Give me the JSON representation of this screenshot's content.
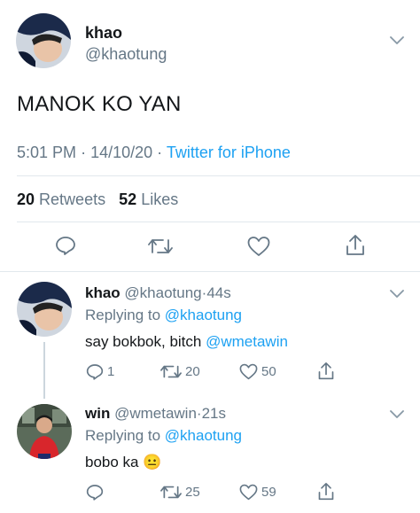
{
  "main_tweet": {
    "name": "khao",
    "handle": "@khaotung",
    "text": "MANOK KO YAN",
    "time": "5:01 PM",
    "date": "14/10/20",
    "separator": "·",
    "source": "Twitter for iPhone",
    "retweets_count": "20",
    "retweets_label": "Retweets",
    "likes_count": "52",
    "likes_label": "Likes"
  },
  "replies": [
    {
      "name": "khao",
      "handle": "@khaotung",
      "separator": "·",
      "time": "44s",
      "replying_prefix": "Replying to",
      "replying_to": "@khaotung",
      "text": "say bokbok, bitch",
      "mention": "@wmetawin",
      "reply_count": "1",
      "retweet_count": "20",
      "like_count": "50"
    },
    {
      "name": "win",
      "handle": "@wmetawin",
      "separator": "·",
      "time": "21s",
      "replying_prefix": "Replying to",
      "replying_to": "@khaotung",
      "text": "bobo ka",
      "emoji": "😐",
      "reply_count": "",
      "retweet_count": "25",
      "like_count": "59"
    }
  ],
  "colors": {
    "accent": "#1da1f2",
    "muted": "#657786",
    "text": "#14171a",
    "divider": "#e1e8ed"
  },
  "icons": [
    "chevron-down-icon",
    "reply-icon",
    "retweet-icon",
    "like-icon",
    "share-icon"
  ]
}
